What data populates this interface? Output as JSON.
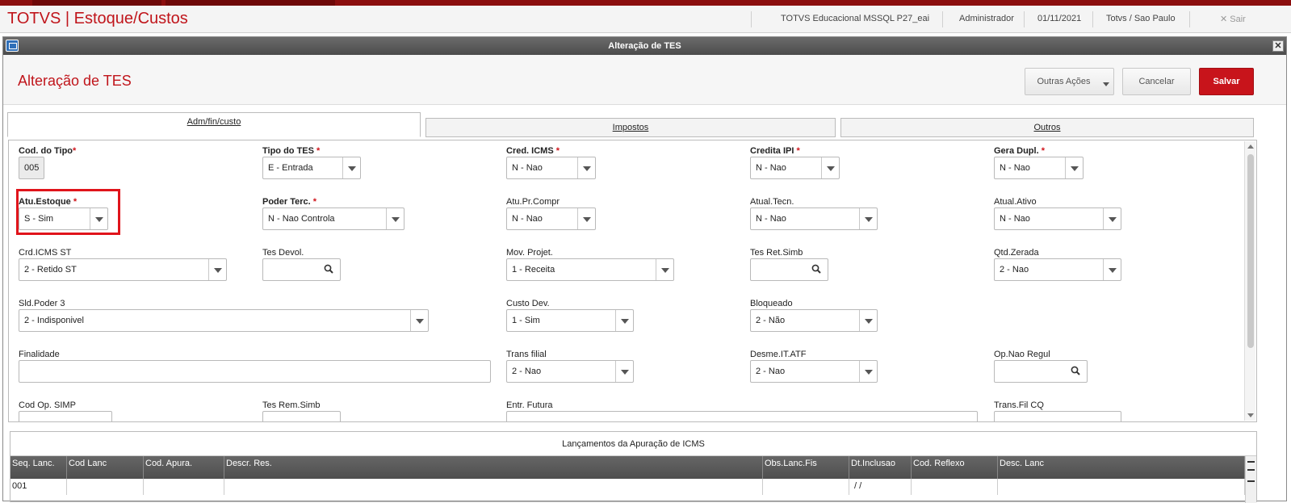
{
  "topbar": {
    "brand": "TOTVS | Estoque/Custos",
    "environment": "TOTVS Educacional MSSQL P27_eai",
    "user": "Administrador",
    "date": "01/11/2021",
    "branch": "Totvs / Sao Paulo",
    "exit_label": "Sair"
  },
  "window": {
    "title": "Alteração de TES"
  },
  "header": {
    "title": "Alteração de TES",
    "other_actions": "Outras Ações",
    "cancel": "Cancelar",
    "save": "Salvar"
  },
  "tabs": [
    "Adm/fin/custo",
    "Impostos",
    "Outros"
  ],
  "fields": [
    {
      "label": "Cod. do Tipo",
      "required": "*",
      "value": "005"
    },
    {
      "label": "Tipo do TES",
      "required": "*",
      "value": "E - Entrada"
    },
    {
      "label": "Cred. ICMS",
      "required": "*",
      "value": "N - Nao"
    },
    {
      "label": "Credita IPI",
      "required": "*",
      "value": "N - Nao"
    },
    {
      "label": "Gera Dupl.",
      "required": "*",
      "value": "N - Nao"
    },
    {
      "label": "Atu.Estoque",
      "required": "*",
      "value": "S - Sim"
    },
    {
      "label": "Poder Terc.",
      "required": "*",
      "value": "N - Nao Controla"
    },
    {
      "label": "Atu.Pr.Compr",
      "value": "N - Nao"
    },
    {
      "label": "Atual.Tecn.",
      "value": "N - Nao"
    },
    {
      "label": "Atual.Ativo",
      "value": "N - Nao"
    },
    {
      "label": "Crd.ICMS ST",
      "value": "2 - Retido ST"
    },
    {
      "label": "Tes Devol.",
      "value": ""
    },
    {
      "label": "Mov. Projet.",
      "value": "1 - Receita"
    },
    {
      "label": "Tes Ret.Simb",
      "value": ""
    },
    {
      "label": "Qtd.Zerada",
      "value": "2 - Nao"
    },
    {
      "label": "Sld.Poder 3",
      "value": "2 - Indisponivel"
    },
    {
      "label": "Custo Dev.",
      "value": "1 - Sim"
    },
    {
      "label": "Bloqueado",
      "value": "2 - Não"
    },
    {
      "label": "Finalidade",
      "value": ""
    },
    {
      "label": "Trans filial",
      "value": "2 - Nao"
    },
    {
      "label": "Desme.IT.ATF",
      "value": "2 - Nao"
    },
    {
      "label": "Op.Nao Regul",
      "value": ""
    },
    {
      "label": "Cod Op. SIMP",
      "value": ""
    },
    {
      "label": "Tes Rem.Simb",
      "value": ""
    },
    {
      "label": "Entr. Futura",
      "value": ""
    },
    {
      "label": "Trans.Fil CQ",
      "value": ""
    }
  ],
  "grid": {
    "title": "Lançamentos da Apuração de ICMS",
    "columns": [
      "Seq. Lanc.",
      "Cod Lanc",
      "Cod. Apura.",
      "Descr. Res.",
      "Obs.Lanc.Fis",
      "Dt.Inclusao",
      "Cod. Reflexo",
      "Desc. Lanc"
    ],
    "row": [
      "001",
      "",
      "",
      "",
      "",
      "/ /",
      "",
      ""
    ]
  },
  "colors": {
    "brand": "#c0151b",
    "save": "#c8141b",
    "highlight": "#e0141b",
    "title_bar": "#555555"
  }
}
